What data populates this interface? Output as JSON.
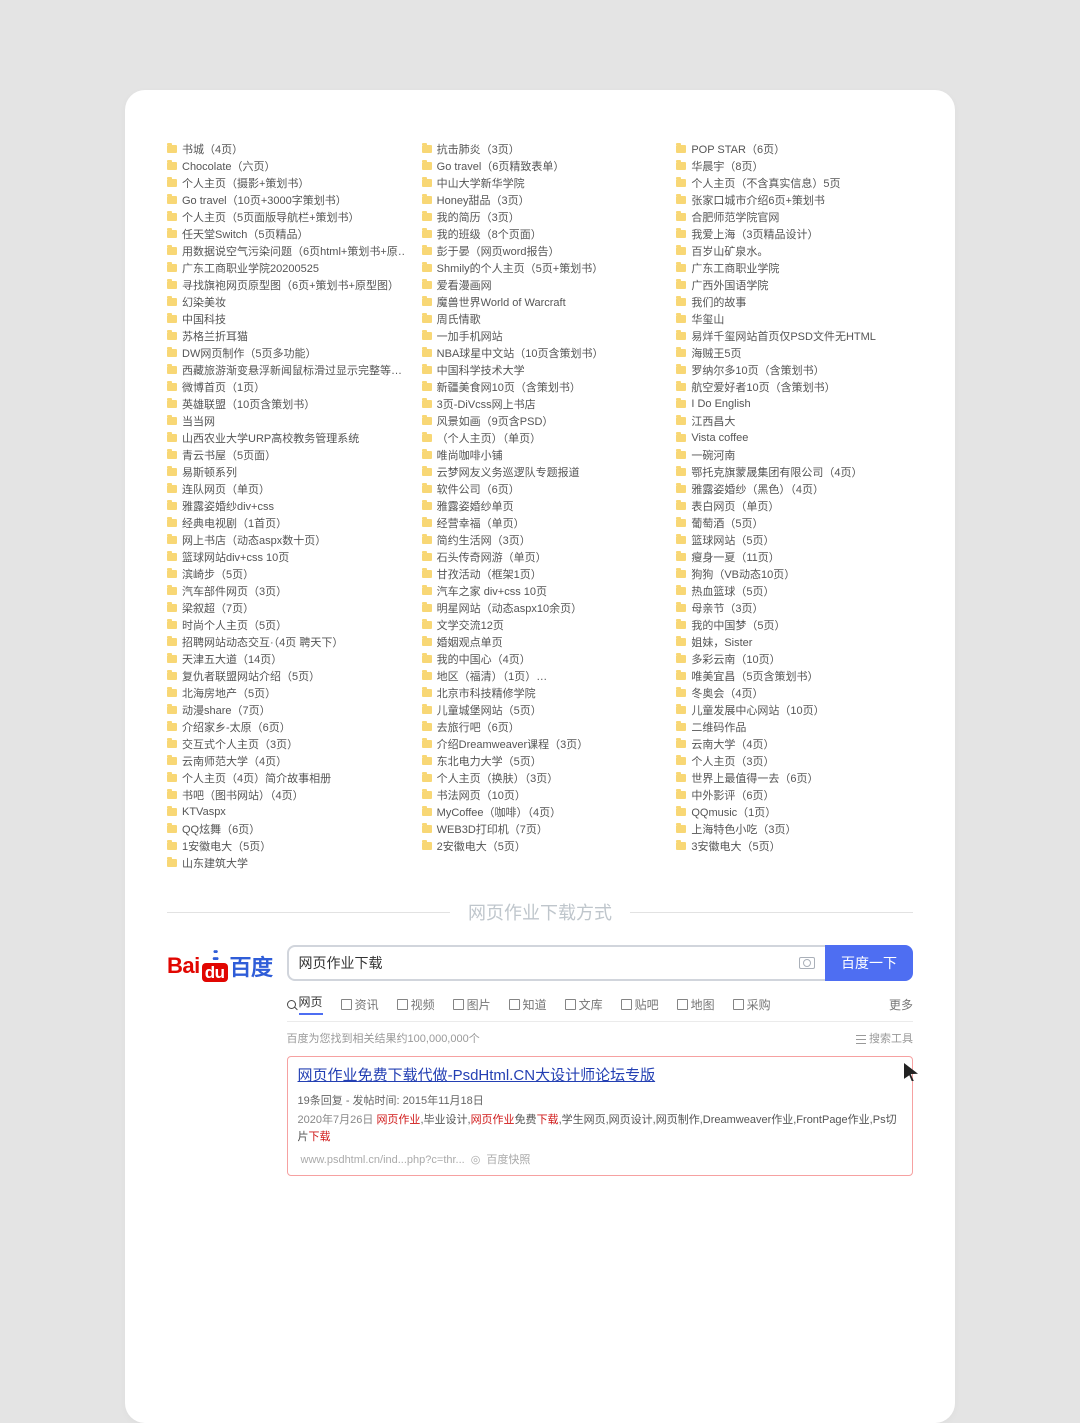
{
  "columns": [
    [
      "书城（4页）",
      "Chocolate（六页）",
      "个人主页（摄影+策划书）",
      "Go travel（10页+3000字策划书）",
      "个人主页（5页面版导航栏+策划书）",
      "任天堂Switch（5页精品）",
      "用数据说空气污染问题（6页html+策划书+原…",
      "广东工商职业学院20200525",
      "寻找旗袍网页原型图（6页+策划书+原型图）",
      "幻染美妆",
      "中国科技",
      "苏格兰折耳猫",
      "DW网页制作（5页多功能）",
      "西藏旅游渐变悬浮新闻鼠标滑过显示完整等…",
      "微博首页（1页）",
      "英雄联盟（10页含策划书）",
      "当当网",
      "山西农业大学URP高校教务管理系统",
      "青云书屋（5页面）",
      "易斯顿系列",
      "连队网页（单页）",
      "雅露姿婚纱div+css",
      "经典电视剧（1首页）",
      "网上书店（动态aspx数十页）",
      "篮球网站div+css  10页",
      "滨崎步（5页）",
      "汽车部件网页（3页）",
      "梁叙超（7页）",
      "时尚个人主页（5页）",
      "招聘网站动态交互·（4页  聘天下）",
      "天津五大道（14页）",
      "复仇者联盟网站介绍（5页）",
      "北海房地产（5页）",
      "动漫share（7页）",
      "介绍家乡-太原（6页）",
      "交互式个人主页（3页）",
      "云南师范大学（4页）",
      "个人主页（4页）简介故事相册",
      "书吧（图书网站）（4页）",
      "KTVaspx",
      "QQ炫舞（6页）",
      "1安徽电大（5页）",
      "山东建筑大学"
    ],
    [
      "抗击肺炎（3页）",
      "Go travel（6页精致表单）",
      "中山大学新华学院",
      "Honey甜品（3页）",
      "我的简历（3页）",
      "我的班级（8个页面）",
      "彭于晏（网页word报告）",
      "Shmily的个人主页（5页+策划书）",
      "爱看漫画网",
      "魔兽世界World of Warcraft",
      "周氏情歌",
      "一加手机网站",
      "NBA球星中文站（10页含策划书）",
      "中国科学技术大学",
      "新疆美食网10页（含策划书）",
      "3页-DiVcss网上书店",
      "风景如画（9页含PSD）",
      "（个人主页）（单页）",
      "唯尚咖啡小铺",
      "云梦网友义务巡逻队专题报道",
      "软件公司（6页）",
      "雅露姿婚纱单页",
      "经营幸福（单页）",
      "简约生活网（3页）",
      "石头传奇网游（单页）",
      "甘孜活动（框架1页）",
      "汽车之家  div+css  10页",
      "明星网站（动态aspx10余页）",
      "文学交流12页",
      "婚姻观点单页",
      "我的中国心（4页）",
      "地区（福清）（1页）…",
      "北京市科技精修学院",
      "儿童城堡网站（5页）",
      "去旅行吧（6页）",
      "介绍Dreamweaver课程（3页）",
      "东北电力大学（5页）",
      "个人主页（换肤）（3页）",
      "书法网页（10页）",
      "MyCoffee（咖啡）（4页）",
      "WEB3D打印机（7页）",
      "2安徽电大（5页）"
    ],
    [
      "POP STAR（6页）",
      "华晨宇（8页）",
      "个人主页（不含真实信息）5页",
      "张家口城市介绍6页+策划书",
      "合肥师范学院官网",
      "我爱上海（3页精品设计）",
      "百岁山矿泉水。",
      "广东工商职业学院",
      "广西外国语学院",
      "我们的故事",
      "华玺山",
      "易烊千玺网站首页仅PSD文件无HTML",
      "海贼王5页",
      "罗纳尔多10页（含策划书）",
      "航空爱好者10页（含策划书）",
      "I Do English",
      "江西昌大",
      "Vista coffee",
      "一碗河南",
      "鄂托克旗蒙晟集团有限公司（4页）",
      "雅露姿婚纱（黑色）（4页）",
      "表白网页（单页）",
      "葡萄酒（5页）",
      "篮球网站（5页）",
      "瘦身一夏（11页）",
      "狗狗（VB动态10页）",
      "热血篮球（5页）",
      "母亲节（3页）",
      "我的中国梦（5页）",
      "姐妹，Sister",
      "多彩云南（10页）",
      "唯美宜昌（5页含策划书）",
      "冬奥会（4页）",
      "儿童发展中心网站（10页）",
      "二维码作品",
      "云南大学（4页）",
      "个人主页（3页）",
      "世界上最值得一去（6页）",
      "中外影评（6页）",
      "QQmusic（1页）",
      "上海特色小吃（3页）",
      "3安徽电大（5页）"
    ]
  ],
  "separator_title": "网页作业下载方式",
  "baidu": {
    "bai": "Bai",
    "du_pill": "du",
    "du_cn": "百度",
    "search_value": "网页作业下载",
    "search_button": "百度一下",
    "tabs": [
      "网页",
      "资讯",
      "视频",
      "图片",
      "知道",
      "文库",
      "贴吧",
      "地图",
      "采购"
    ],
    "more": "更多",
    "meta_left": "百度为您找到相关结果约100,000,000个",
    "meta_right": "搜索工具",
    "result": {
      "t1": "网页作业",
      "t2": "免费",
      "t3": "下载",
      "t4": "代做-PsdHtml.CN大设计师论坛专版",
      "sub": "19条回复 - 发帖时间:  2015年11月18日",
      "body_date": "2020年7月26日 ",
      "body1": "网页作业",
      "body2": ",毕业设计,",
      "body3": "网页作业",
      "body4": "免费",
      "body5": "下载",
      "body6": ",学生网页,网页设计,网页制作,Dreamweaver作业,FrontPage作业,Ps切片",
      "body7": "下载",
      "url": "www.psdhtml.cn/ind...php?c=thr...",
      "cache": "百度快照"
    }
  }
}
